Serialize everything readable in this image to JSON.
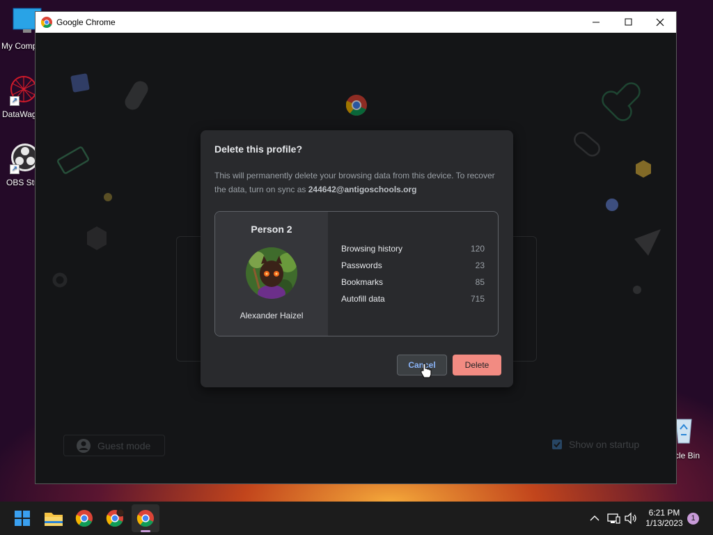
{
  "desktop": {
    "icons": [
      {
        "label": "My Comp"
      },
      {
        "label": "DataWag"
      },
      {
        "label": "OBS Stu"
      },
      {
        "label": "cle Bin"
      }
    ]
  },
  "window": {
    "title": "Google Chrome"
  },
  "picker": {
    "guest_mode_label": "Guest mode",
    "show_on_startup_label": "Show on startup",
    "show_on_startup_checked": true
  },
  "dialog": {
    "title": "Delete this profile?",
    "description_prefix": "This will permanently delete your browsing data from this device. To recover the data, turn on sync as ",
    "account_email": "244642@antigoschools.org",
    "profile_name": "Person 2",
    "user_name": "Alexander Haizel",
    "stats": [
      {
        "label": "Browsing history",
        "value": "120"
      },
      {
        "label": "Passwords",
        "value": "23"
      },
      {
        "label": "Bookmarks",
        "value": "85"
      },
      {
        "label": "Autofill data",
        "value": "715"
      }
    ],
    "cancel_label": "Cancel",
    "delete_label": "Delete"
  },
  "taskbar": {
    "apps": [
      "start-icon",
      "file-explorer-icon",
      "chrome-icon",
      "chrome-profile-icon",
      "chrome-active-icon"
    ],
    "time": "6:21 PM",
    "date": "1/13/2023",
    "notification_count": "1"
  },
  "colors": {
    "accent": "#8ab4f8",
    "delete": "#f28b82",
    "dialog_bg": "#292a2d"
  }
}
